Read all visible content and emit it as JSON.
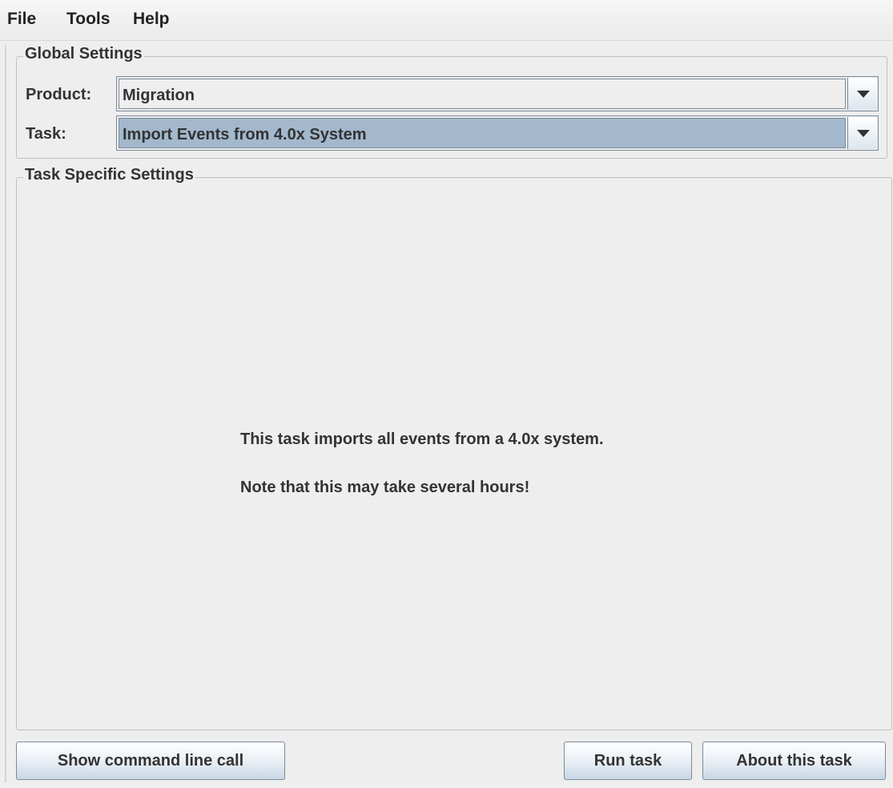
{
  "menubar": {
    "items": [
      "File",
      "Tools",
      "Help"
    ]
  },
  "global_settings": {
    "title": "Global Settings",
    "product_label": "Product:",
    "product_value": "Migration",
    "task_label": "Task:",
    "task_value": "Import Events from 4.0x System"
  },
  "task_settings": {
    "title": "Task Specific Settings",
    "line1": "This task imports all events from a 4.0x system.",
    "line2": "Note that this may take several hours!"
  },
  "buttons": {
    "show_command": "Show command line call",
    "run_task": "Run task",
    "about_task": "About this task"
  },
  "colors": {
    "background": "#eeeeee",
    "selection": "#a3b8cc",
    "border": "#7a8a99"
  }
}
